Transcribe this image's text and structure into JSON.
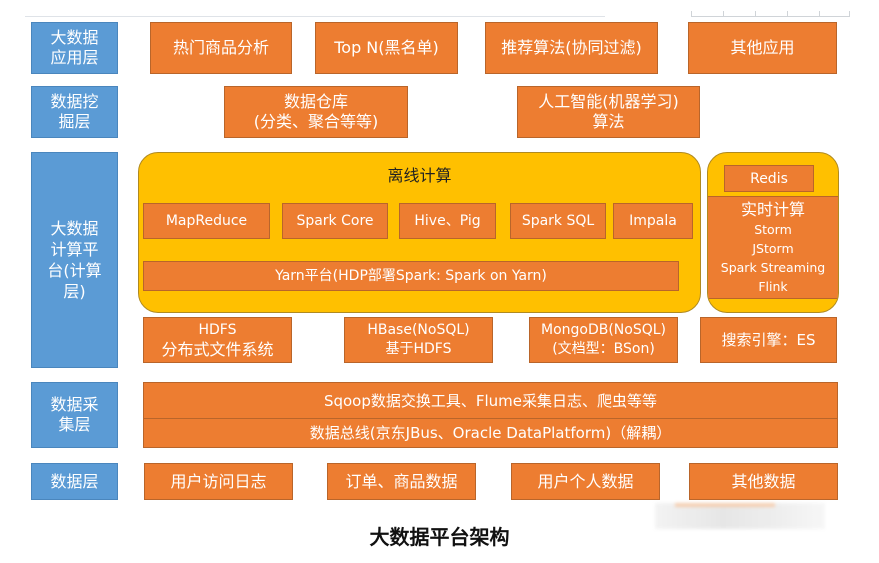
{
  "colors": {
    "layer_label": "#5b9bd5",
    "component": "#ed7d31",
    "group": "#ffc000"
  },
  "layers": {
    "application": {
      "label": "大数据应用层",
      "label_lines": [
        "大数据",
        "应用层"
      ],
      "items": [
        "热门商品分析",
        "Top N(黑名单)",
        "推荐算法(协同过滤)",
        "其他应用"
      ]
    },
    "mining": {
      "label": "数据挖掘层",
      "label_lines": [
        "数据挖",
        "掘层"
      ],
      "items": [
        {
          "lines": [
            "数据仓库",
            "(分类、聚合等等)"
          ]
        },
        {
          "lines": [
            "人工智能(机器学习)",
            "算法"
          ]
        }
      ]
    },
    "compute": {
      "label": "大数据计算平台(计算层)",
      "label_lines": [
        "大数据",
        "计算平",
        "台(计算",
        "层)"
      ],
      "offline": {
        "title": "离线计算",
        "engines": [
          "MapReduce",
          "Spark Core",
          "Hive、Pig",
          "Spark SQL",
          "Impala"
        ],
        "resource_manager": "Yarn平台(HDP部署Spark: Spark on Yarn)"
      },
      "realtime": {
        "cache": "Redis",
        "title": "实时计算",
        "engines": [
          "Storm",
          "JStorm",
          "Spark Streaming",
          "Flink"
        ]
      },
      "storage": [
        {
          "lines": [
            "HDFS",
            "分布式文件系统"
          ]
        },
        {
          "lines": [
            "HBase(NoSQL)",
            "基于HDFS"
          ]
        },
        {
          "lines": [
            "MongoDB(NoSQL)",
            "(文档型：BSon)"
          ]
        },
        {
          "lines": [
            "搜索引擎：ES"
          ]
        }
      ]
    },
    "collection": {
      "label": "数据采集层",
      "label_lines": [
        "数据采",
        "集层"
      ],
      "items": [
        "Sqoop数据交换工具、Flume采集日志、爬虫等等",
        "数据总线(京东JBus、Oracle DataPlatform)（解耦）"
      ]
    },
    "data": {
      "label": "数据层",
      "items": [
        "用户访问日志",
        "订单、商品数据",
        "用户个人数据",
        "其他数据"
      ]
    }
  },
  "caption": "大数据平台架构"
}
